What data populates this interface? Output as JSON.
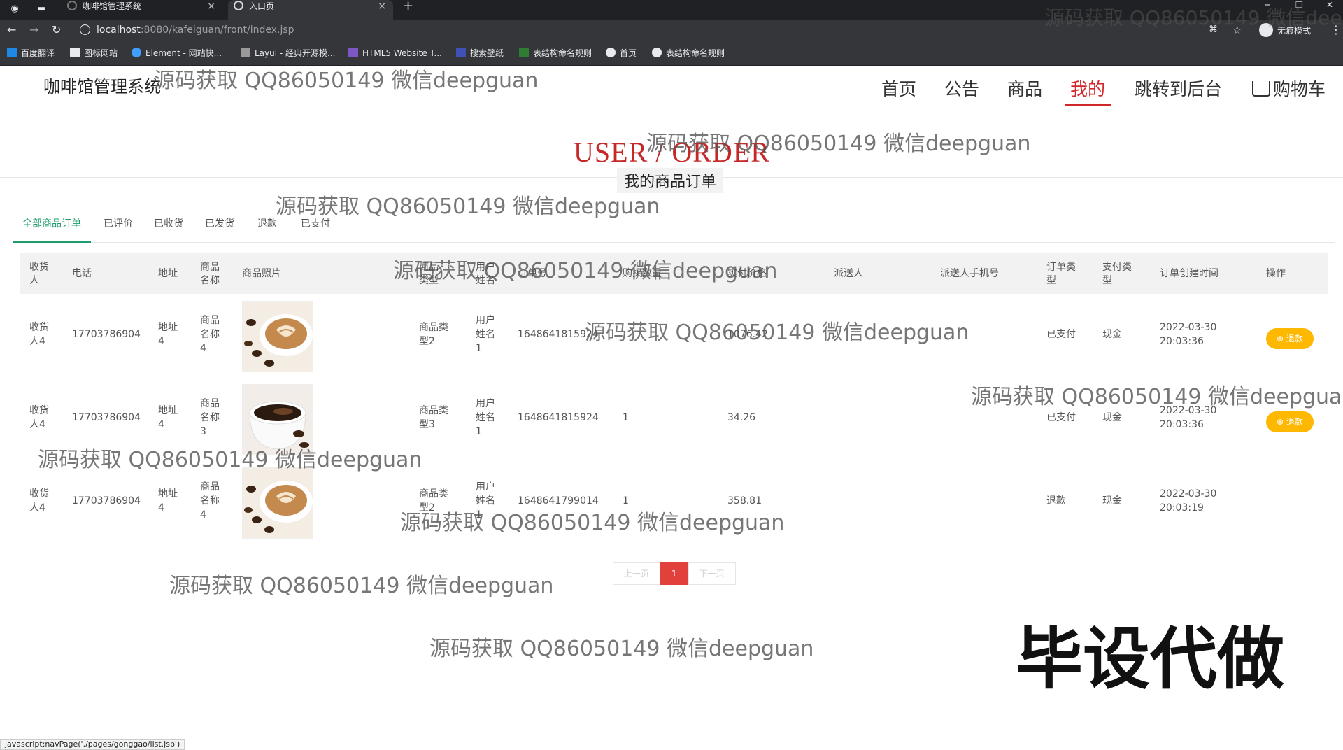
{
  "browser": {
    "tabs": [
      {
        "title": "咖啡馆管理系统",
        "close": "×"
      },
      {
        "title": "入口页",
        "close": "×"
      }
    ],
    "new_tab": "+",
    "url_host": "localhost",
    "url_path": ":8080/kafeiguan/front/index.jsp",
    "incognito_label": "无痕模式",
    "bookmarks": [
      {
        "label": "百度翻译",
        "color": "#1e88e5"
      },
      {
        "label": "图标网站",
        "color": "#e8eaed"
      },
      {
        "label": "Element - 网站快...",
        "color": "#409eff"
      },
      {
        "label": "Layui - 经典开源模...",
        "color": "#999999"
      },
      {
        "label": "HTML5 Website T...",
        "color": "#7e57c2"
      },
      {
        "label": "搜索壁纸",
        "color": "#3f51b5"
      },
      {
        "label": "表结构命名规则",
        "color": "#2e7d32"
      },
      {
        "label": "首页",
        "color": "#e8eaed"
      },
      {
        "label": "表结构命名规则",
        "color": "#e8eaed"
      }
    ]
  },
  "header": {
    "brand": "咖啡馆管理系统",
    "nav": [
      {
        "label": "首页",
        "active": false
      },
      {
        "label": "公告",
        "active": false
      },
      {
        "label": "商品",
        "active": false
      },
      {
        "label": "我的",
        "active": true
      },
      {
        "label": "跳转到后台",
        "active": false
      }
    ],
    "cart_label": "购物车",
    "accent": "#d3262b"
  },
  "section": {
    "title": "USER / ORDER",
    "subtitle": "我的商品订单"
  },
  "order_tabs": [
    {
      "label": "全部商品订单",
      "active": true
    },
    {
      "label": "已评价",
      "active": false
    },
    {
      "label": "已收货",
      "active": false
    },
    {
      "label": "已发货",
      "active": false
    },
    {
      "label": "退款",
      "active": false
    },
    {
      "label": "已支付",
      "active": false
    }
  ],
  "table": {
    "headers": [
      "收货人",
      "电话",
      "地址",
      "商品名称",
      "商品照片",
      "商品类型",
      "用户姓名",
      "订单号",
      "购买数量",
      "实付价格",
      "派送人",
      "派送人手机号",
      "订单类型",
      "支付类型",
      "订单创建时间",
      "操作"
    ],
    "rows": [
      {
        "receiver": "收货人4",
        "phone": "17703786904",
        "address": "地址4",
        "product": "商品名称4",
        "image": "latte-art-coffee",
        "type": "商品类型2",
        "user": "用户姓名1",
        "order_no": "1648641815924",
        "qty": "",
        "price": "1076.42",
        "courier": "",
        "courier_phone": "",
        "order_type": "已支付",
        "pay_type": "现金",
        "created": "2022-03-30 20:03:36",
        "action": "退款"
      },
      {
        "receiver": "收货人4",
        "phone": "17703786904",
        "address": "地址4",
        "product": "商品名称3",
        "image": "black-coffee-cup",
        "type": "商品类型3",
        "user": "用户姓名1",
        "order_no": "1648641815924",
        "qty": "1",
        "price": "34.26",
        "courier": "",
        "courier_phone": "",
        "order_type": "已支付",
        "pay_type": "现金",
        "created": "2022-03-30 20:03:36",
        "action": "退款"
      },
      {
        "receiver": "收货人4",
        "phone": "17703786904",
        "address": "地址4",
        "product": "商品名称4",
        "image": "latte-art-coffee",
        "type": "商品类型2",
        "user": "用户姓名1",
        "order_no": "1648641799014",
        "qty": "1",
        "price": "358.81",
        "courier": "",
        "courier_phone": "",
        "order_type": "退款",
        "pay_type": "现金",
        "created": "2022-03-30 20:03:19",
        "action": ""
      }
    ]
  },
  "pagination": {
    "prev": "上一页",
    "current": "1",
    "next": "下一页"
  },
  "watermark": "源码获取 QQ86050149 微信deepguan",
  "banner": "毕设代做",
  "status_url": "javascript:navPage('./pages/gonggao/list.jsp')"
}
